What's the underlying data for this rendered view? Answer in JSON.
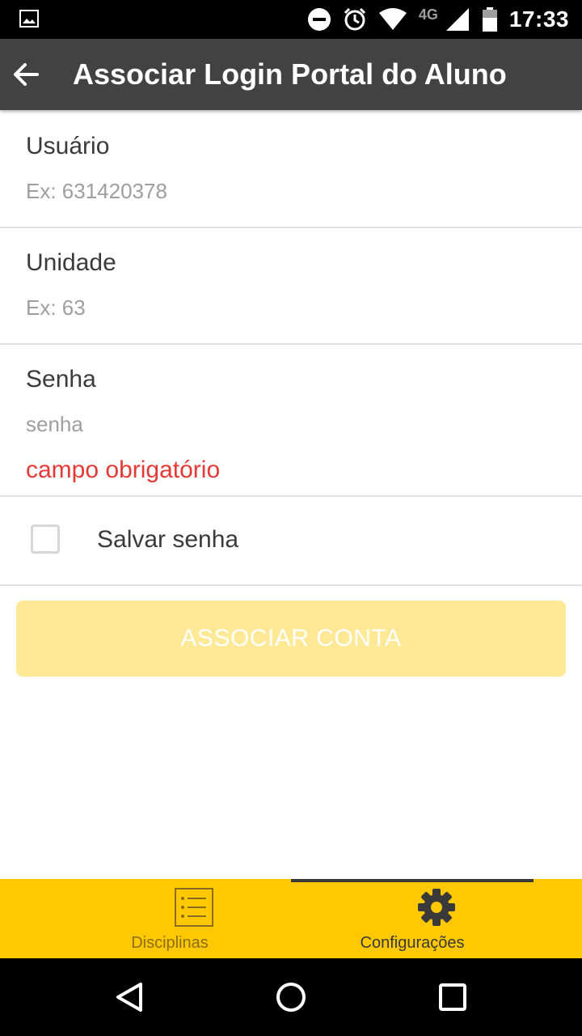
{
  "status_bar": {
    "network": "4G",
    "time": "17:33"
  },
  "app_bar": {
    "title": "Associar Login Portal do Aluno",
    "icon": "arrow-back-icon"
  },
  "form": {
    "usuario": {
      "label": "Usuário",
      "value": "",
      "placeholder": "Ex: 631420378"
    },
    "unidade": {
      "label": "Unidade",
      "value": "",
      "placeholder": "Ex: 63"
    },
    "senha": {
      "label": "Senha",
      "value": "",
      "placeholder": "senha",
      "error": "campo obrigatório"
    },
    "salvar_senha": {
      "label": "Salvar senha",
      "checked": false
    },
    "submit_label": "ASSOCIAR CONTA"
  },
  "tabs": [
    {
      "label": "Disciplinas",
      "icon": "list-icon",
      "active": false
    },
    {
      "label": "Configurações",
      "icon": "gear-icon",
      "active": true
    }
  ],
  "colors": {
    "app_bar": "#424242",
    "accent": "#ffc800",
    "button_disabled": "#ffe896",
    "error": "#e53935"
  }
}
